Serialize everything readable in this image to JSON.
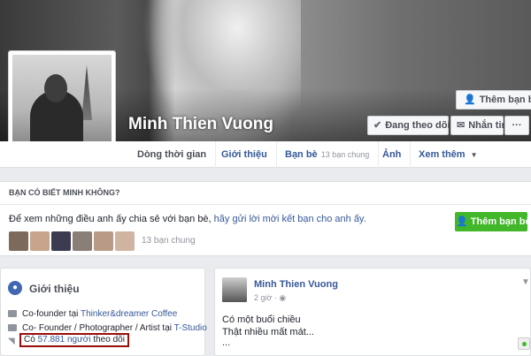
{
  "profile": {
    "name": "Minh Thien Vuong",
    "buttons": {
      "add_friend": "Thêm bạn bè",
      "following": "Đang theo dõi",
      "message": "Nhắn tin",
      "more": "···"
    }
  },
  "nav": {
    "tabs": [
      {
        "label": "Dòng thời gian"
      },
      {
        "label": "Giới thiệu"
      },
      {
        "label": "Bạn bè",
        "sub": "13 bạn chung"
      },
      {
        "label": "Ảnh"
      },
      {
        "label": "Xem thêm"
      }
    ]
  },
  "pymk": {
    "header": "BẠN CÓ BIẾT MINH KHÔNG?",
    "text": "Để xem những điều anh ấy chia sẻ với bạn bè,",
    "link": "hãy gửi lời mời kết bạn cho anh ấy.",
    "button": "Thêm bạn bè",
    "mutual": "13 bạn chung"
  },
  "intro": {
    "title": "Giới thiệu",
    "rows": [
      {
        "prefix": "Co-founder tại",
        "link": "Thinker&dreamer Coffee"
      },
      {
        "prefix": "Co- Founder / Photographer / Artist tại",
        "link": "T-Studio"
      }
    ],
    "followers": {
      "prefix": "Có",
      "link": "57.881 người",
      "suffix": "theo dõi"
    }
  },
  "post": {
    "author": "Minh Thien Vuong",
    "time": "2 giờ · ",
    "lines": [
      "Có một buổi chiều",
      "Thật nhiều mất mát...",
      "..."
    ]
  },
  "colors": {
    "link": "#365899",
    "green": "#42b72a",
    "highlight_border": "#9b0d0d"
  }
}
